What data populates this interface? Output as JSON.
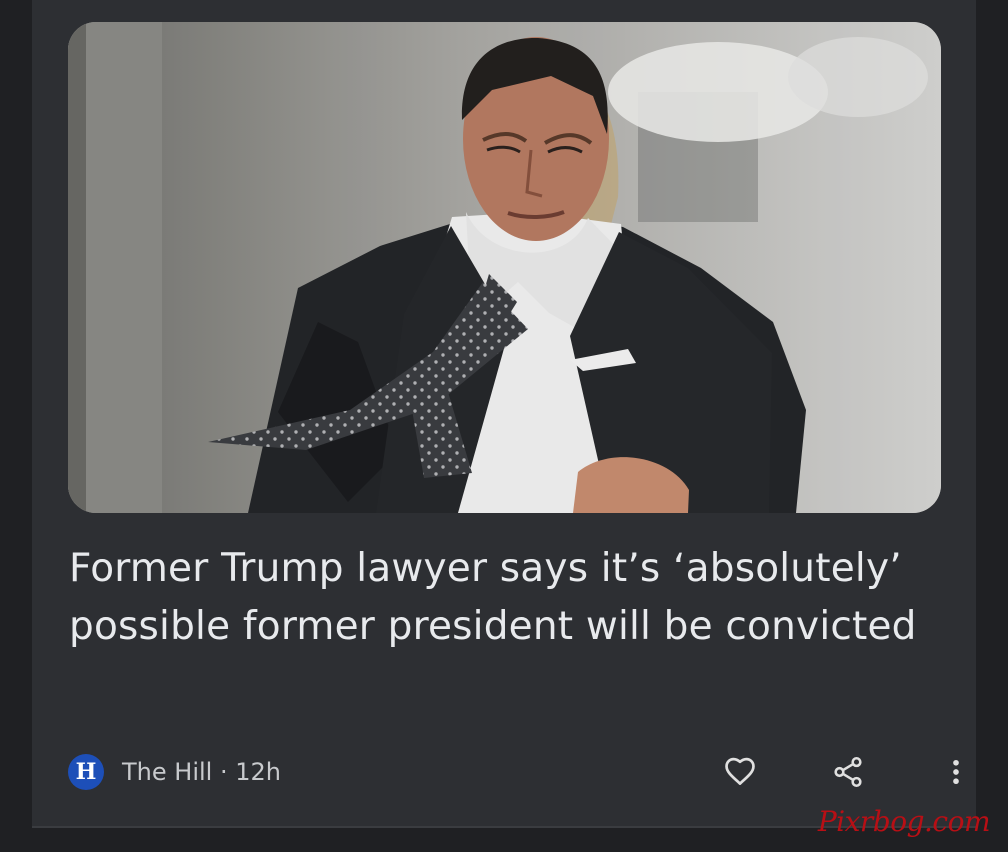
{
  "article": {
    "headline": "Former Trump lawyer says it’s ‘absolutely’ possible former president will be convicted",
    "image_alt": "Man in dark suit with patterned tie walking outdoors",
    "source": {
      "logo_letter": "H",
      "name": "The Hill",
      "separator": " · ",
      "age": "12h"
    },
    "actions": {
      "like_icon": "heart-outline-icon",
      "share_icon": "share-icon",
      "more_icon": "more-vert-icon"
    }
  },
  "watermark": "Pixrbog.com",
  "colors": {
    "page_background": "#1f2023",
    "card_background": "#2d2f33",
    "headline_text": "#e8eaed",
    "secondary_text": "#c8cacd",
    "source_logo_blue": "#1d4fb8",
    "watermark_red": "#b80f15"
  }
}
